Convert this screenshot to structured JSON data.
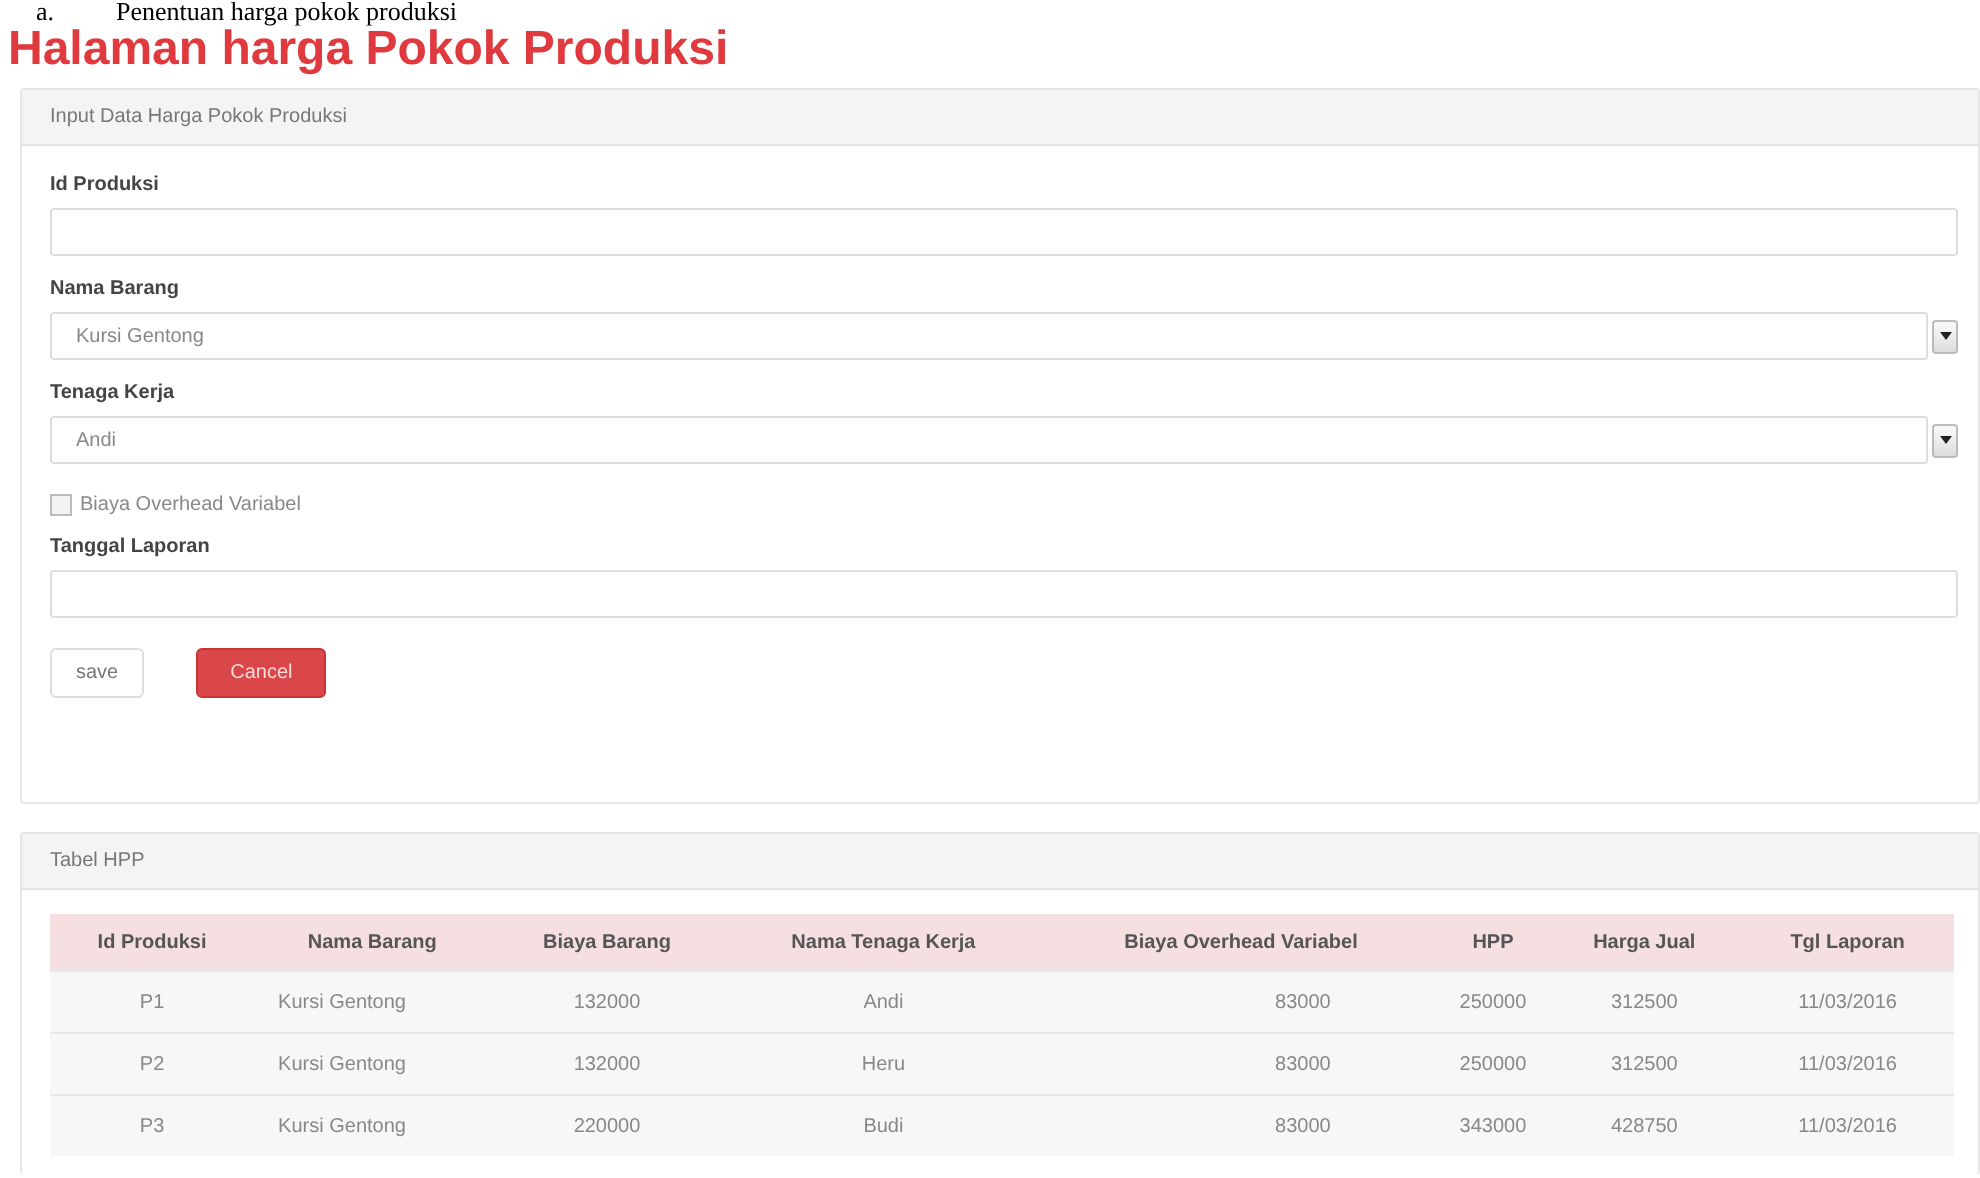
{
  "caption": {
    "marker": "a.",
    "text": "Penentuan harga pokok produksi"
  },
  "title": "Halaman harga Pokok Produksi",
  "form_panel": {
    "heading": "Input Data Harga Pokok Produksi",
    "fields": [
      {
        "kind": "text",
        "label": "Id Produksi"
      },
      {
        "kind": "select",
        "label": "Nama Barang",
        "value": "Kursi Gentong"
      },
      {
        "kind": "select",
        "label": "Tenaga Kerja",
        "value": "Andi"
      },
      {
        "kind": "checkbox",
        "label": "Biaya Overhead Variabel",
        "checked": false
      },
      {
        "kind": "text",
        "label": "Tanggal Laporan"
      }
    ],
    "buttons": [
      {
        "kind": "default",
        "label": "save"
      },
      {
        "kind": "danger",
        "label": "Cancel"
      }
    ]
  },
  "table_panel": {
    "heading": "Tabel HPP",
    "columns": [
      "Id Produksi",
      "Nama Barang",
      "Biaya Barang",
      "Nama Tenaga Kerja",
      "Biaya Overhead Variabel",
      "HPP",
      "Harga Jual",
      "Tgl Laporan"
    ],
    "rows": [
      [
        "P1",
        "Kursi Gentong",
        "132000",
        "Andi",
        "83000",
        "250000",
        "312500",
        "11/03/2016"
      ],
      [
        "P2",
        "Kursi Gentong",
        "132000",
        "Heru",
        "83000",
        "250000",
        "312500",
        "11/03/2016"
      ],
      [
        "P3",
        "Kursi Gentong",
        "220000",
        "Budi",
        "83000",
        "343000",
        "428750",
        "11/03/2016"
      ]
    ]
  }
}
